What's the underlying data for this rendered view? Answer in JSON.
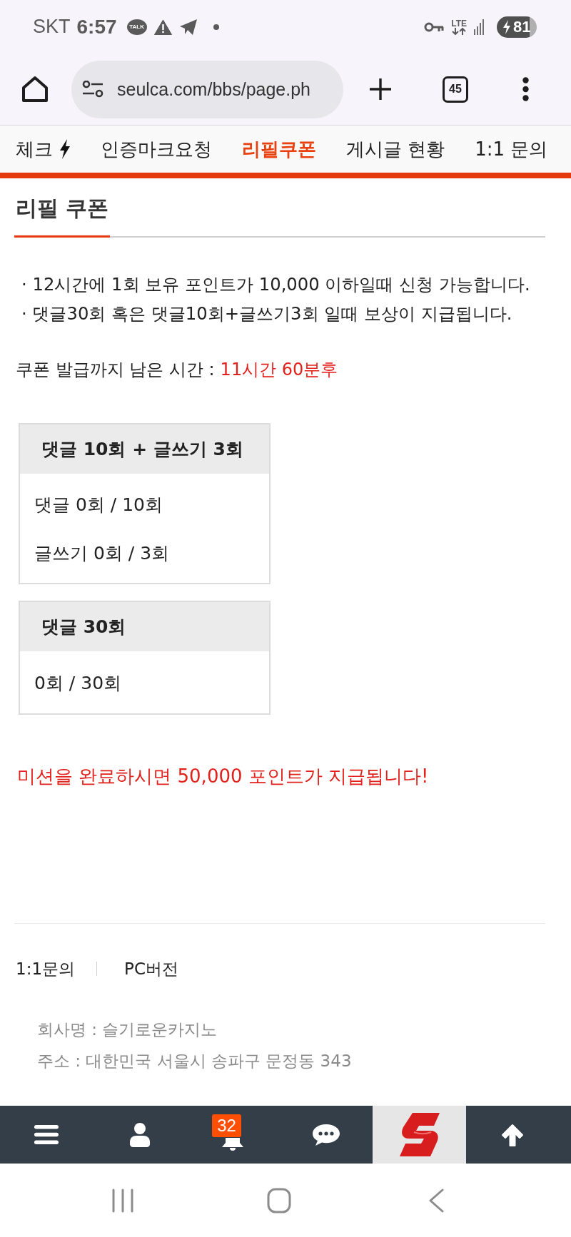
{
  "status_bar": {
    "carrier": "SKT",
    "time": "6:57",
    "app_label": "TALK",
    "network": "LTE",
    "battery": "81"
  },
  "browser": {
    "url": "seulca.com/bbs/page.ph",
    "tab_count": "45"
  },
  "nav_tabs": [
    {
      "label": "체크",
      "kind": "icon",
      "selected": false
    },
    {
      "label": "인증마크요청",
      "kind": "text",
      "selected": false
    },
    {
      "label": "리필쿠폰",
      "kind": "text",
      "selected": true
    },
    {
      "label": "게시글 현황",
      "kind": "text",
      "selected": false
    },
    {
      "label": "1:1 문의",
      "kind": "text",
      "selected": false
    }
  ],
  "page_title": "리필 쿠폰",
  "rules": [
    "· 12시간에 1회 보유 포인트가 10,000 이하일때 신청 가능합니다.",
    "· 댓글30회 혹은 댓글10회+글쓰기3회 일때 보상이 지급됩니다."
  ],
  "countdown": {
    "label": "쿠폰 발급까지 남은 시간 :",
    "value": "11시간 60분후"
  },
  "missions": [
    {
      "title": "댓글 10회 + 글쓰기 3회",
      "lines": [
        "댓글 0회 / 10회",
        "글쓰기 0회 / 3회"
      ]
    },
    {
      "title": "댓글 30회",
      "lines": [
        "0회 / 30회"
      ]
    }
  ],
  "reward_notice": "미션을 완료하시면 50,000 포인트가 지급됩니다!",
  "footer": {
    "links": [
      "1:1문의",
      "PC버전"
    ],
    "info": [
      "회사명 : 슬기로운카지노",
      "주소 : 대한민국 서울시 송파구 문정동 343"
    ]
  },
  "bottom_nav": {
    "badge": "32"
  }
}
